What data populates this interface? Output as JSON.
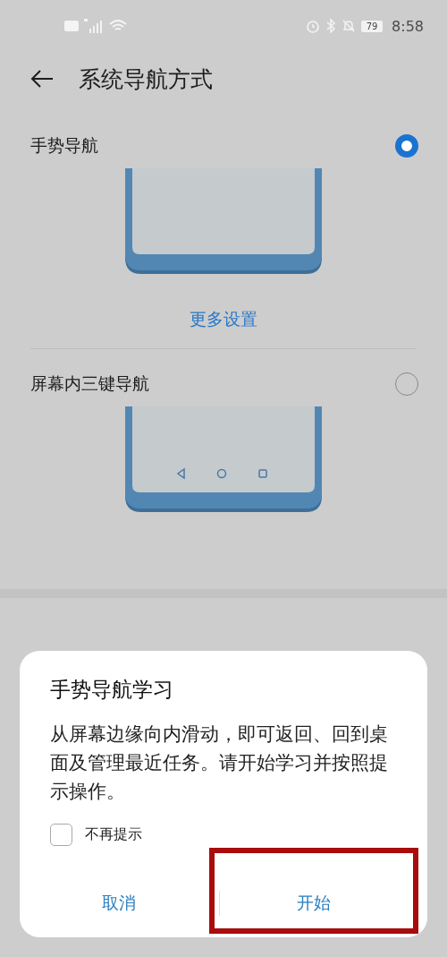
{
  "status_bar": {
    "battery": "79",
    "time": "8:58"
  },
  "header": {
    "title": "系统导航方式"
  },
  "options": [
    {
      "label": "手势导航",
      "selected": true,
      "kind": "gesture",
      "link": "更多设置"
    },
    {
      "label": "屏幕内三键导航",
      "selected": false,
      "kind": "three_key"
    }
  ],
  "dialog": {
    "title": "手势导航学习",
    "message": "从屏幕边缘向内滑动，即可返回、回到桌面及管理最近任务。请开始学习并按照提示操作。",
    "checkbox": {
      "label": "不再提示",
      "checked": false
    },
    "buttons": [
      {
        "label": "取消",
        "highlighted": false
      },
      {
        "label": "开始",
        "highlighted": true
      }
    ]
  }
}
